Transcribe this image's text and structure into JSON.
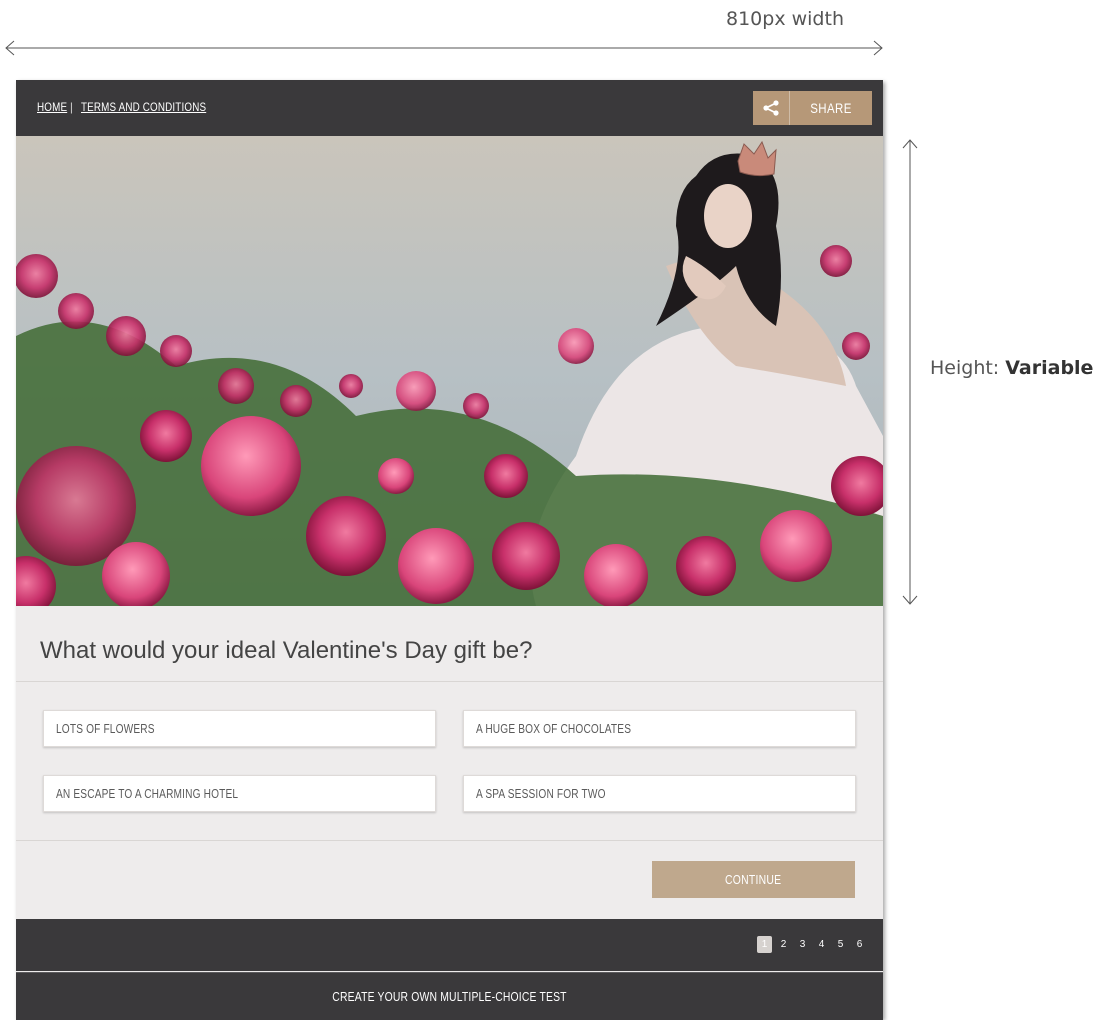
{
  "annotations": {
    "width_label": "810px width",
    "height_label_prefix": "Height: ",
    "height_label_value": "Variable"
  },
  "nav": {
    "home": "HOME",
    "separator": "|",
    "terms": "TERMS AND CONDITIONS"
  },
  "share": {
    "icon": "share-icon",
    "label": "SHARE"
  },
  "question": "What would your ideal Valentine's Day gift be?",
  "options": [
    "LOTS OF FLOWERS",
    "A HUGE BOX OF CHOCOLATES",
    "AN ESCAPE TO A CHARMING HOTEL",
    "A SPA SESSION FOR TWO"
  ],
  "continue_label": "CONTINUE",
  "pages": [
    "1",
    "2",
    "3",
    "4",
    "5",
    "6"
  ],
  "active_page": "1",
  "footer_label": "CREATE YOUR OWN MULTIPLE-CHOICE TEST",
  "colors": {
    "bar": "#3a393b",
    "accent": "#b69878",
    "panel": "#eeecec"
  }
}
